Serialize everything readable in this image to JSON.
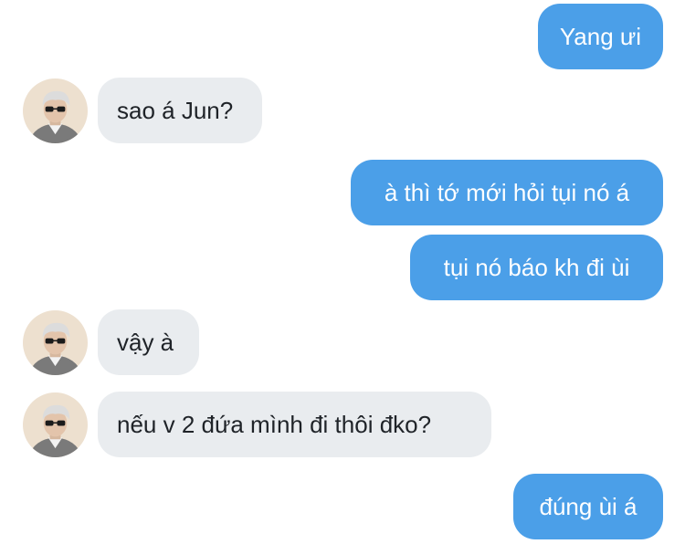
{
  "conversation": {
    "messages": [
      {
        "sender": "me",
        "text": "Yang ưi"
      },
      {
        "sender": "contact",
        "text": "sao á Jun?"
      },
      {
        "sender": "me",
        "text": "à thì tớ mới hỏi tụi nó á"
      },
      {
        "sender": "me",
        "text": "tụi nó báo kh đi ùi"
      },
      {
        "sender": "contact",
        "text": "vậy à"
      },
      {
        "sender": "contact",
        "text": "nếu v 2 đứa mình đi thôi đko?"
      },
      {
        "sender": "me",
        "text": "đúng ùi á"
      }
    ]
  },
  "colors": {
    "sent_bubble": "#4b9fe8",
    "received_bubble": "#e9ecef",
    "sent_text": "#ffffff",
    "received_text": "#1f2328"
  },
  "icons": {
    "contact_avatar": "contact-avatar-photo"
  }
}
